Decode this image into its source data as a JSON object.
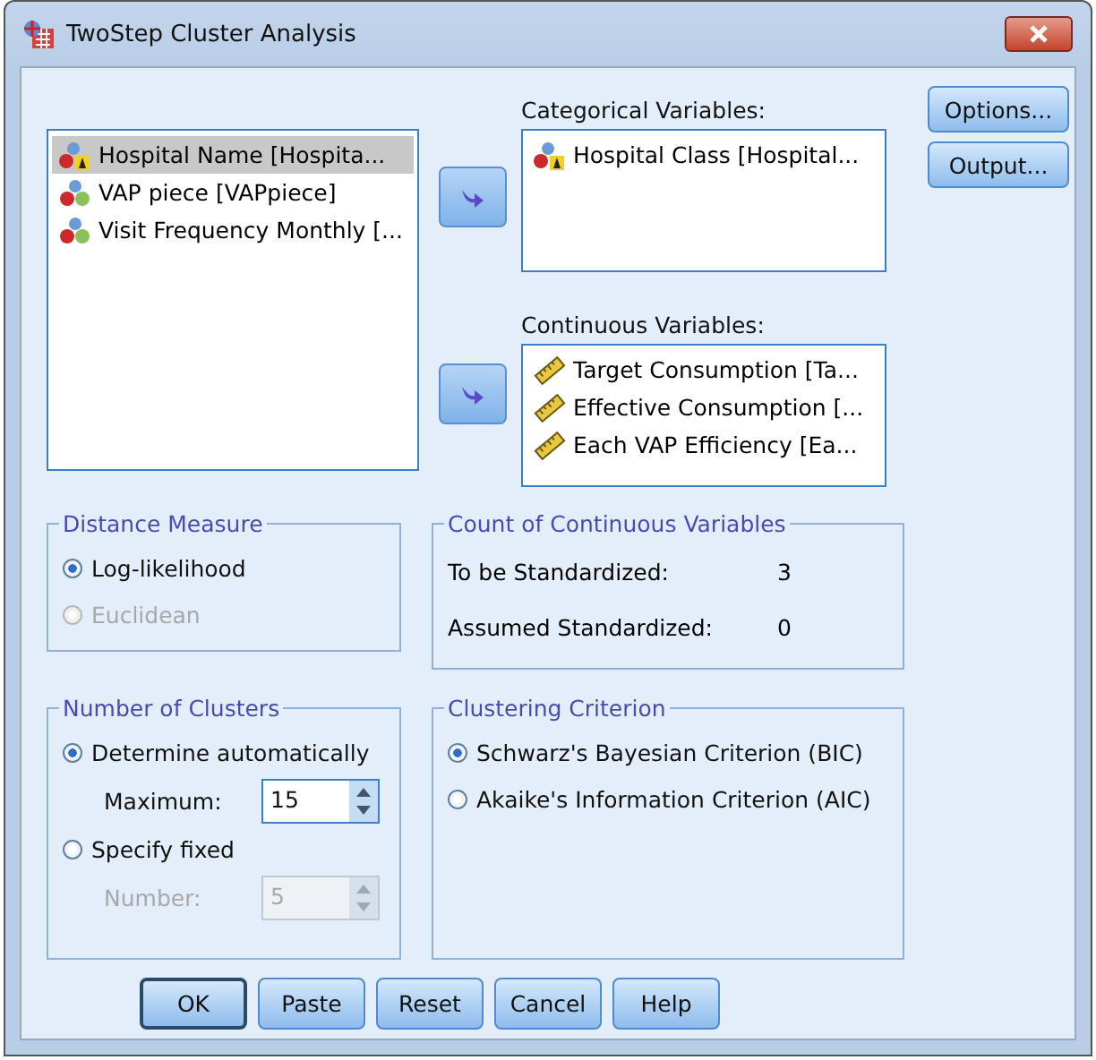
{
  "window": {
    "title": "TwoStep Cluster Analysis"
  },
  "source_list": {
    "items": [
      {
        "label": "Hospital Name [Hospita...",
        "kind": "nominal",
        "selected": true
      },
      {
        "label": "VAP piece [VAPpiece]",
        "kind": "ordinal",
        "selected": false
      },
      {
        "label": "Visit Frequency Monthly [...",
        "kind": "ordinal",
        "selected": false
      }
    ]
  },
  "categorical": {
    "label": "Categorical Variables:",
    "items": [
      {
        "label": "Hospital Class [Hospital...",
        "kind": "nominal"
      }
    ]
  },
  "continuous": {
    "label": "Continuous Variables:",
    "items": [
      {
        "label": "Target Consumption [Ta...",
        "kind": "scale"
      },
      {
        "label": "Effective Consumption  [...",
        "kind": "scale"
      },
      {
        "label": "Each VAP Efficiency  [Ea...",
        "kind": "scale"
      }
    ]
  },
  "side_buttons": [
    "Options...",
    "Output..."
  ],
  "distance_measure": {
    "title": "Distance Measure",
    "options": [
      {
        "label": "Log-likelihood",
        "selected": true,
        "disabled": false
      },
      {
        "label": "Euclidean",
        "selected": false,
        "disabled": true
      }
    ]
  },
  "count": {
    "title": "Count of Continuous Variables",
    "rows": [
      {
        "label": "To be Standardized:",
        "value": "3"
      },
      {
        "label": "Assumed Standardized:",
        "value": "0"
      }
    ]
  },
  "number_of_clusters": {
    "title": "Number of Clusters",
    "options": [
      {
        "label": "Determine automatically",
        "selected": true,
        "field": {
          "label": "Maximum:",
          "value": "15",
          "disabled": false
        }
      },
      {
        "label": "Specify fixed",
        "selected": false,
        "field": {
          "label": "Number:",
          "value": "5",
          "disabled": true
        }
      }
    ]
  },
  "clustering_criterion": {
    "title": "Clustering Criterion",
    "options": [
      {
        "label": "Schwarz's Bayesian Criterion (BIC)",
        "selected": true,
        "disabled": false
      },
      {
        "label": "Akaike's Information Criterion (AIC)",
        "selected": false,
        "disabled": false
      }
    ]
  },
  "buttons": [
    {
      "label": "OK",
      "default": true
    },
    {
      "label": "Paste",
      "default": false
    },
    {
      "label": "Reset",
      "default": false
    },
    {
      "label": "Cancel",
      "default": false
    },
    {
      "label": "Help",
      "default": false
    }
  ]
}
